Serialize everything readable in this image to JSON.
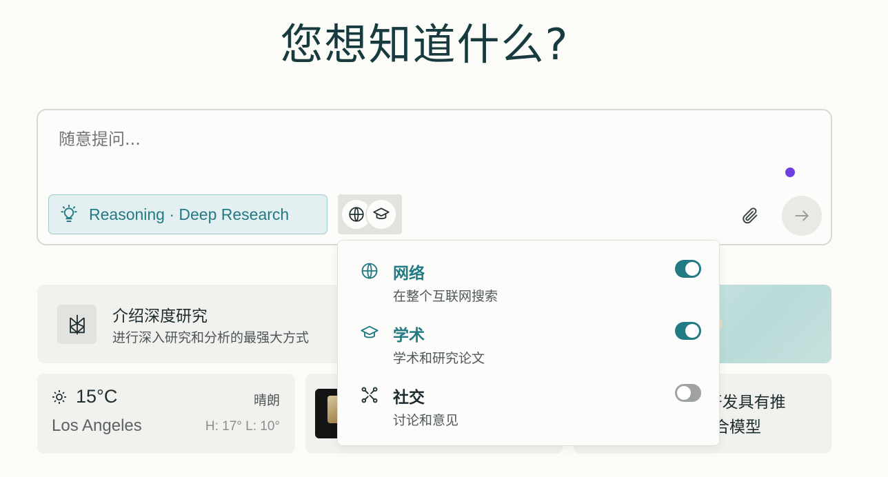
{
  "title": "您想知道什么?",
  "search": {
    "placeholder": "随意提问..."
  },
  "mode_chip": {
    "label": "Reasoning · Deep Research",
    "icon": "lightbulb-icon"
  },
  "sources_button": {
    "icons": [
      "globe-icon",
      "graduation-cap-icon"
    ]
  },
  "colors": {
    "accent": "#227a82",
    "status_dot": "#6d3fe0",
    "toggle_off": "#9ea2a0"
  },
  "sources_menu": {
    "options": [
      {
        "label": "网络",
        "description": "在整个互联网搜索",
        "icon": "globe-icon",
        "enabled": true,
        "label_color": "#227a82"
      },
      {
        "label": "学术",
        "description": "学术和研究论文",
        "icon": "graduation-cap-icon",
        "enabled": true,
        "label_color": "#227a82"
      },
      {
        "label": "社交",
        "description": "讨论和意见",
        "icon": "network-icon",
        "enabled": false,
        "label_color": "#1c2c2e"
      }
    ]
  },
  "research_card": {
    "title": "介绍深度研究",
    "subtitle": "进行深入研究和分析的最强大方式"
  },
  "weather": {
    "temperature": "15°C",
    "condition": "晴朗",
    "city": "Los Angeles",
    "high_low": "H: 17° L: 10°"
  },
  "news_card": {
    "text_line1": "c开发具有推",
    "text_line2": "混合模型"
  }
}
